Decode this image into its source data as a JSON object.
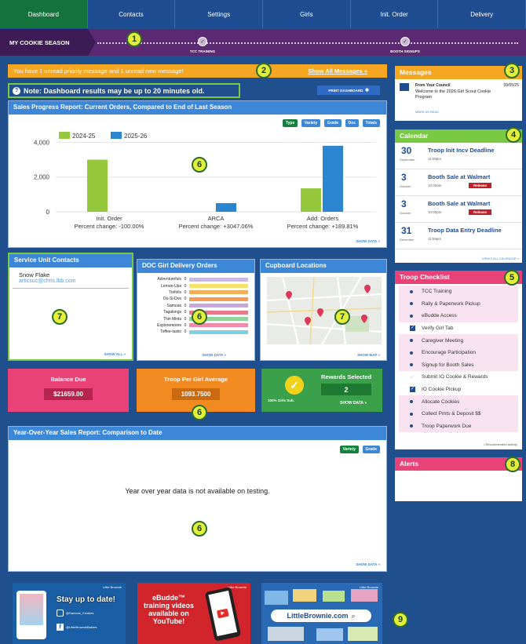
{
  "nav": {
    "tabs": [
      "Dashboard",
      "Contacts",
      "Settings",
      "Girls",
      "Init. Order",
      "Delivery"
    ]
  },
  "season": {
    "label": "MY COOKIE SEASON",
    "milestones": [
      "TCC TRAINING",
      "BOOTH SIGNUPS"
    ]
  },
  "alert": {
    "text": "You have 1 unread priority message and 1 unread new message!",
    "link": "Show All Messages »"
  },
  "note": {
    "text": "Note: Dashboard results may be up to 20 minutes old."
  },
  "print": {
    "label": "PRINT DASHBOARD"
  },
  "callouts": [
    "1",
    "2",
    "3",
    "4",
    "5",
    "6",
    "7",
    "8",
    "9"
  ],
  "sales": {
    "title": "Sales Progress Report: Current Orders, Compared to End of Last Season",
    "buttons": [
      "Type",
      "Variety",
      "Grade",
      "Doc",
      "Totals"
    ],
    "show_data": "SHOW DATA »",
    "percent_changes": [
      "Percent change: -100.00%",
      "Percent change: +3047.06%",
      "Percent change: +189.81%"
    ]
  },
  "chart_data": {
    "type": "bar",
    "categories": [
      "Init. Order",
      "ARCA",
      "Add. Orders"
    ],
    "series": [
      {
        "name": "2024-25",
        "color": "#95c83d",
        "values": [
          3000,
          0,
          1350
        ]
      },
      {
        "name": "2025-26",
        "color": "#2b86cf",
        "values": [
          0,
          500,
          3800
        ]
      }
    ],
    "ylim": [
      0,
      4200
    ],
    "yticks": [
      "4,000",
      "2,000",
      "0"
    ],
    "ytick_values": [
      4000,
      2000,
      0
    ],
    "grid": true,
    "legend": "top-left"
  },
  "suc": {
    "title": "Service Unit Contacts",
    "name": "Snow Flake",
    "email": "articsuc@chris.lbb.com",
    "show_all": "SHOW ALL »"
  },
  "doc": {
    "title": "DOC Girl Delivery Orders",
    "rows": [
      {
        "label": "Adventurefuls",
        "value": "0",
        "color": "#c9b9e4"
      },
      {
        "label": "Lemon-Ups",
        "value": "0",
        "color": "#f5e36c"
      },
      {
        "label": "Trefoils",
        "value": "0",
        "color": "#f3b05a"
      },
      {
        "label": "Do-Si-Dos",
        "value": "0",
        "color": "#f39c52"
      },
      {
        "label": "Samoas",
        "value": "0",
        "color": "#c7a6dc"
      },
      {
        "label": "Tagalongs",
        "value": "0",
        "color": "#e87a8c"
      },
      {
        "label": "Thin Mints",
        "value": "0",
        "color": "#8fd39a"
      },
      {
        "label": "Exploremores",
        "value": "0",
        "color": "#f08aa8"
      },
      {
        "label": "Toffee-tastic",
        "value": "0",
        "color": "#7fd0e0"
      }
    ],
    "show_data": "SHOW DATA »"
  },
  "cupboard": {
    "title": "Cupboard Locations",
    "show_map": "SHOW MAP »"
  },
  "balance": {
    "label": "Balance Due",
    "value": "$21659.00",
    "color": "#e94278"
  },
  "per_girl": {
    "label": "Troop Per Girl Average",
    "value": "1093.7500",
    "color": "#f28a22"
  },
  "rewards": {
    "label": "Rewards Selected",
    "value": "2",
    "sub": "100% Girls Sub.",
    "show_data": "SHOW DATA »",
    "color": "#3aa04a"
  },
  "yoy": {
    "title": "Year-Over-Year Sales Report: Comparison to Date",
    "buttons": [
      "Variety",
      "Grade"
    ],
    "message": "Year over year data is not available on testing.",
    "show_data": "SHOW DATA »"
  },
  "messages": {
    "title": "Messages",
    "from": "From Your Council",
    "date": "09/05/25",
    "body": "Welcome to the 2026 Girl Scout Cookie Program",
    "mark": "MARK AS READ"
  },
  "calendar": {
    "title": "Calendar",
    "events": [
      {
        "day": "30",
        "month": "September",
        "title": "Troop Init Incv Deadline",
        "time": "11:59pm",
        "tag": ""
      },
      {
        "day": "3",
        "month": "October",
        "title": "Booth Sale at Walmart",
        "time": "10:00am",
        "tag": "Release"
      },
      {
        "day": "3",
        "month": "October",
        "title": "Booth Sale at Walmart",
        "time": "10:00pm",
        "tag": "Release"
      },
      {
        "day": "31",
        "month": "December",
        "title": "Troop Data Entry Deadline",
        "time": "11:59pm",
        "tag": ""
      }
    ],
    "view_full": "VIEW FULL CALENDAR »"
  },
  "checklist": {
    "title": "Troop Checklist",
    "items": [
      {
        "label": "TCC Training",
        "type": "dot",
        "highlight": true
      },
      {
        "label": "Rally & Paperwork Pickup",
        "type": "dot",
        "highlight": true
      },
      {
        "label": "eBudde Access",
        "type": "dot",
        "highlight": true
      },
      {
        "label": "Verify Girl Tab",
        "type": "check",
        "highlight": false
      },
      {
        "label": "Caregiver Meeting",
        "type": "dot",
        "highlight": true
      },
      {
        "label": "Encourage Participation",
        "type": "dot",
        "highlight": true
      },
      {
        "label": "Signup for Booth Sales",
        "type": "dot",
        "highlight": true
      },
      {
        "label": "Submit IO Cookie & Rewards",
        "type": "faint",
        "highlight": false
      },
      {
        "label": "IO Cookie Pickup",
        "type": "check",
        "highlight": false
      },
      {
        "label": "Allocate Cookies",
        "type": "dot",
        "highlight": true
      },
      {
        "label": "Collect Pmts & Deposit $$",
        "type": "dot",
        "highlight": true
      },
      {
        "label": "Troop Paperwork Due",
        "type": "dot",
        "highlight": true
      }
    ],
    "footnote": "• Recommended activity"
  },
  "alerts": {
    "title": "Alerts"
  },
  "banners": {
    "social": {
      "brand": "Little Brownie",
      "headline": "Stay up to date!",
      "handle1": "@Samoas_Cookies",
      "handle2": "@LittleBrownieBakers"
    },
    "video": {
      "brand": "Little Brownie",
      "text": "eBudde™ training videos available on YouTube!"
    },
    "site": {
      "brand": "Little Brownie",
      "url": "LittleBrownie.com"
    }
  }
}
